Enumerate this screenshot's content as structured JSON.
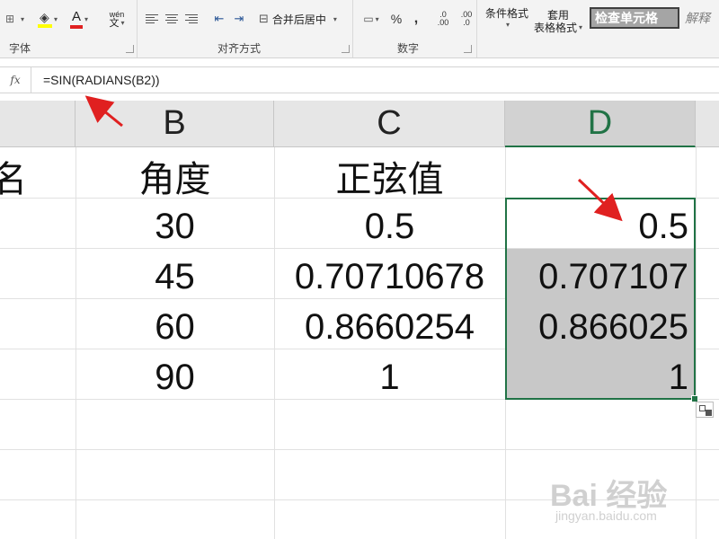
{
  "ribbon": {
    "groups": {
      "font": "字体",
      "alignment": "对齐方式",
      "number": "数字"
    },
    "font_color_letter": "A",
    "phonetic_top": "wén",
    "phonetic_bottom": "文",
    "merge_center": "合并后居中",
    "percent": "%",
    "comma": ",",
    "inc_decimal": ".00",
    "dec_decimal": ".0",
    "conditional_format": "条件格式",
    "table_format_top": "套用",
    "table_format_bottom": "表格格式",
    "style_check_cell": "检查单元格",
    "style_explain": "解释"
  },
  "formula_bar": {
    "fx": "fx",
    "formula": "=SIN(RADIANS(B2))"
  },
  "columns": {
    "b": "B",
    "c": "C",
    "d": "D"
  },
  "rows": [
    {
      "a": "名",
      "b": "角度",
      "c": "正弦值",
      "d": ""
    },
    {
      "b": "30",
      "c": "0.5",
      "d": "0.5"
    },
    {
      "b": "45",
      "c": "0.70710678",
      "d": "0.707107"
    },
    {
      "b": "60",
      "c": "0.8660254",
      "d": "0.866025"
    },
    {
      "b": "90",
      "c": "1",
      "d": "1"
    }
  ],
  "watermark": {
    "main": "Bai 经验",
    "sub": "jingyan.baidu.com"
  },
  "colors": {
    "accent_green": "#217346",
    "arrow_red": "#e02020",
    "selection_gray": "#c8c8c8"
  }
}
